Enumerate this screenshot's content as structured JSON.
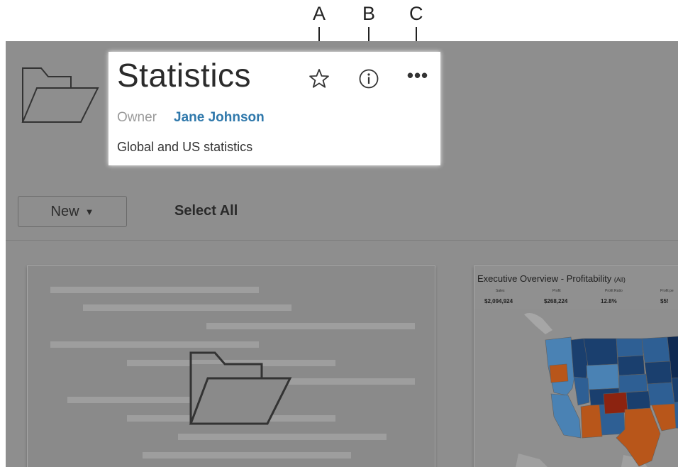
{
  "callouts": {
    "a": "A",
    "b": "B",
    "c": "C"
  },
  "project": {
    "title": "Statistics",
    "owner_label": "Owner",
    "owner_name": "Jane Johnson",
    "description": "Global and US statistics"
  },
  "icons": {
    "folder": "folder-icon",
    "favorite": "star-icon",
    "info": "info-icon",
    "more": "more-actions-icon"
  },
  "toolbar": {
    "new_label": "New",
    "select_all_label": "Select All"
  },
  "thumbnail": {
    "title": "Executive Overview - Profitability",
    "filter": "(All)",
    "kpis": [
      {
        "label": "Sales",
        "value": "$2,094,924"
      },
      {
        "label": "Profit",
        "value": "$268,224"
      },
      {
        "label": "Profit Ratio",
        "value": "12.8%"
      },
      {
        "label": "Profit pe",
        "value": "$5!"
      }
    ]
  },
  "colors": {
    "link": "#2f78ab",
    "overlay": "#8e8e8e",
    "map_navy": "#1a3f6e",
    "map_blue": "#2e5f94",
    "map_light": "#4a82b4",
    "map_orange": "#b8561a",
    "map_red": "#8c2310"
  }
}
